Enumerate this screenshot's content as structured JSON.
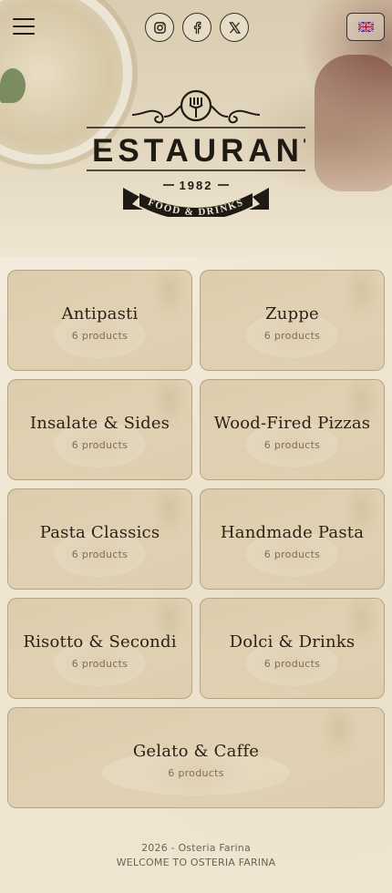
{
  "header": {
    "menu_icon": "hamburger-menu-icon",
    "socials": [
      {
        "name": "instagram-icon"
      },
      {
        "name": "facebook-icon"
      },
      {
        "name": "x-twitter-icon"
      }
    ],
    "language": {
      "icon": "uk-flag-icon"
    }
  },
  "logo": {
    "name": "RESTAURANT",
    "year": "1982",
    "tagline": "FOOD & DRINKS"
  },
  "categories": [
    {
      "title": "Antipasti",
      "count": "6 products"
    },
    {
      "title": "Zuppe",
      "count": "6 products"
    },
    {
      "title": "Insalate & Sides",
      "count": "6 products"
    },
    {
      "title": "Wood-Fired Pizzas",
      "count": "6 products"
    },
    {
      "title": "Pasta Classics",
      "count": "6 products"
    },
    {
      "title": "Handmade Pasta",
      "count": "6 products"
    },
    {
      "title": "Risotto & Secondi",
      "count": "6 products"
    },
    {
      "title": "Dolci & Drinks",
      "count": "6 products"
    },
    {
      "title": "Gelato & Caffe",
      "count": "6 products"
    }
  ],
  "footer": {
    "copyright": "2026 - Osteria Farina",
    "welcome": "WELCOME TO OSTERIA FARINA"
  },
  "colors": {
    "background": "#efe6d2",
    "text": "#2a2218",
    "muted": "#7b6f60"
  }
}
